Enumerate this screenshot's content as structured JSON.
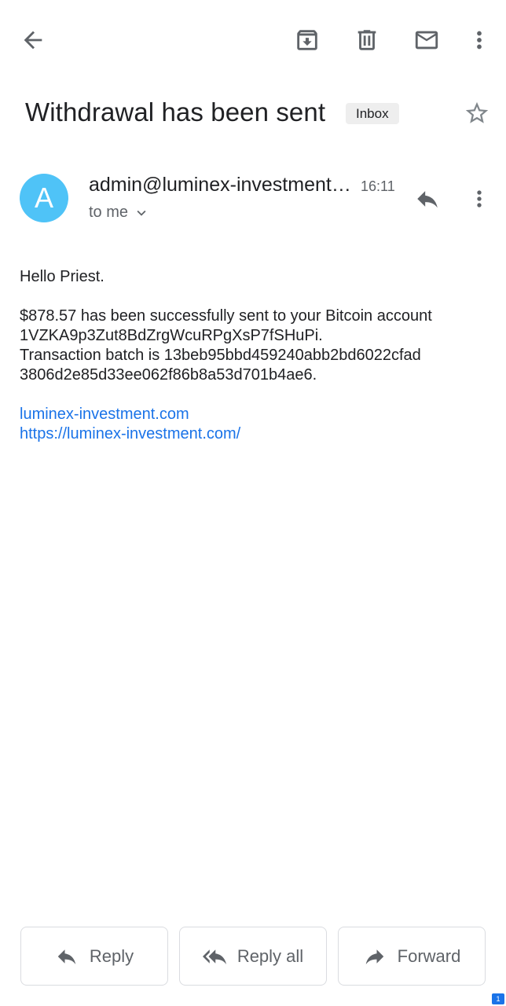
{
  "toolbar": {
    "back_icon": "back-arrow-icon",
    "archive_icon": "archive-icon",
    "delete_icon": "trash-icon",
    "mark_unread_icon": "mail-icon",
    "more_icon": "more-vert-icon"
  },
  "email": {
    "subject": "Withdrawal has been sent",
    "label": "Inbox",
    "sender_avatar_letter": "A",
    "avatar_color": "#4fc3f7",
    "from": "admin@luminex-investment.com",
    "time": "16:11",
    "to": "to me",
    "body": {
      "greeting": "Hello Priest.",
      "line1": "$878.57 has been successfully sent to your Bitcoin account",
      "line2": "1VZKA9p3Zut8BdZrgWcuRPgXsP7fSHuPi.",
      "line3": "Transaction batch is 13beb95bbd459240abb2bd6022cfad",
      "line4": "3806d2e85d33ee062f86b8a53d701b4ae6.",
      "link1": "luminex-investment.com",
      "link2": "https://luminex-investment.com/"
    }
  },
  "actions": {
    "reply": "Reply",
    "reply_all": "Reply all",
    "forward": "Forward"
  },
  "colors": {
    "link": "#1a73e8",
    "icon": "#5f6368"
  }
}
